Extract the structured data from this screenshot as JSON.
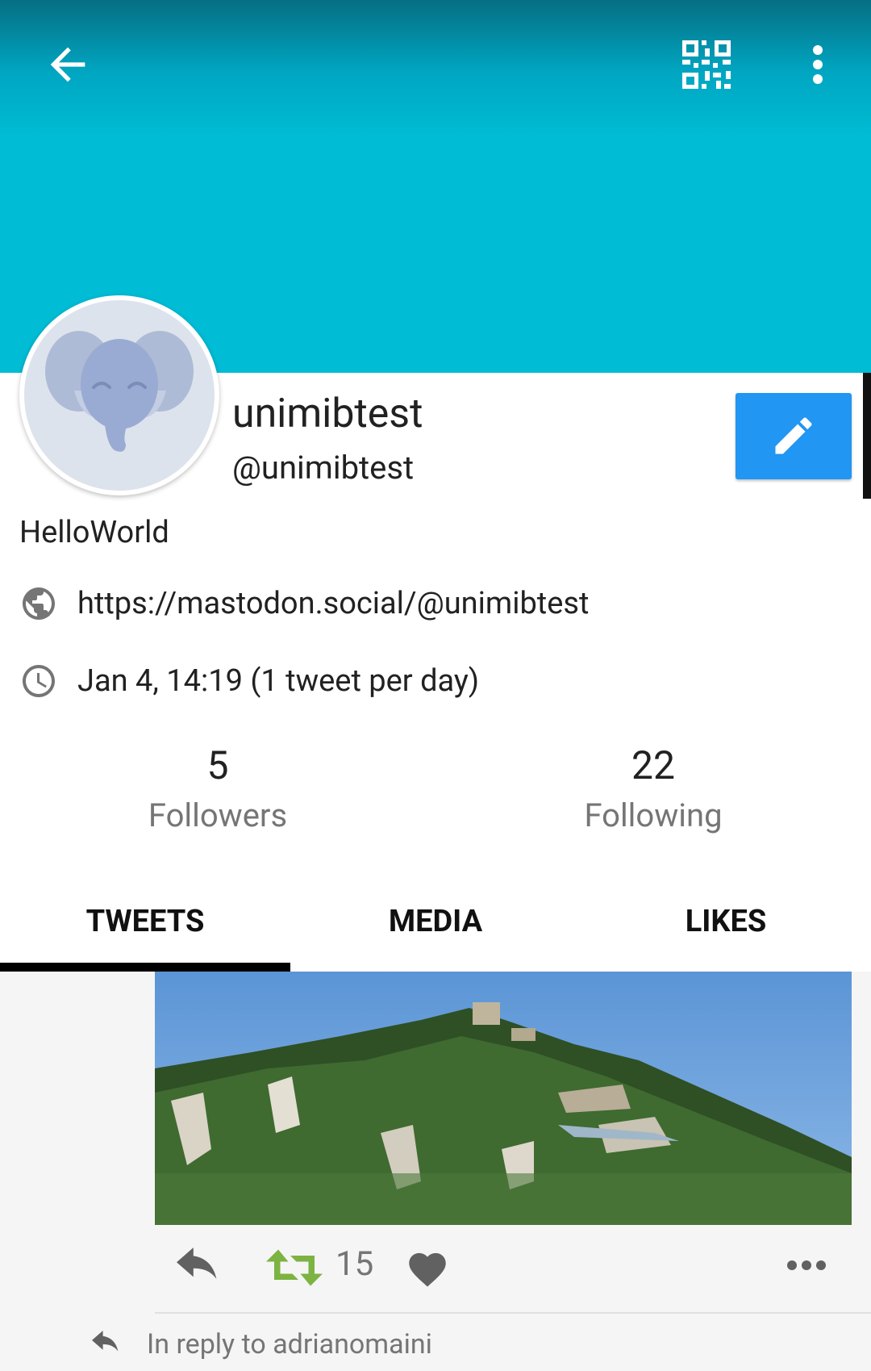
{
  "toolbar": {
    "back_icon": "arrow-left-icon",
    "qr_icon": "qr-code-icon",
    "more_icon": "more-vertical-icon",
    "header_color": "#00bcd4"
  },
  "profile": {
    "display_name": "unimibtest",
    "handle": "@unimibtest",
    "bio": "HelloWorld",
    "url": "https://mastodon.social/@unimibtest",
    "joined": "Jan 4, 14:19 (1 tweet per day)",
    "avatar_icon": "elephant-avatar-icon",
    "edit_icon": "pencil-icon",
    "edit_button_color": "#2196f3"
  },
  "stats": {
    "followers_count": "5",
    "followers_label": "Followers",
    "following_count": "22",
    "following_label": "Following"
  },
  "tabs": [
    {
      "label": "TWEETS",
      "selected": true
    },
    {
      "label": "MEDIA",
      "selected": false
    },
    {
      "label": "LIKES",
      "selected": false
    }
  ],
  "tweet": {
    "retweet_count": "15",
    "retweet_color": "#7cb342",
    "reply_note": "In reply to adrianomaini"
  }
}
